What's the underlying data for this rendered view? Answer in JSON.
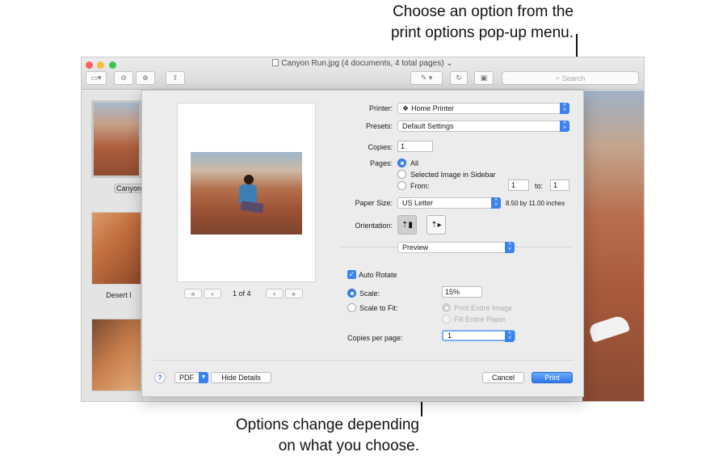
{
  "callouts": {
    "top_line1": "Choose an option from the",
    "top_line2": "print options pop-up menu.",
    "bottom_line1": "Options change depending",
    "bottom_line2": "on what you choose."
  },
  "window": {
    "title": "Canyon Run.jpg (4 documents, 4 total pages)",
    "search_placeholder": "Search"
  },
  "sidebar": {
    "items": [
      {
        "label": "Canyon "
      },
      {
        "label": "Desert I"
      }
    ]
  },
  "print": {
    "pager": {
      "first": "«",
      "prev": "‹",
      "page_text": "1 of 4",
      "next": "›",
      "last": "»"
    },
    "printer_label": "Printer:",
    "printer_value": "Home Printer",
    "presets_label": "Presets:",
    "presets_value": "Default Settings",
    "copies_label": "Copies:",
    "copies_value": "1",
    "pages_label": "Pages:",
    "pages_all": "All",
    "pages_selected": "Selected Image in Sidebar",
    "pages_from": "From:",
    "from_value": "1",
    "to_label": "to:",
    "to_value": "1",
    "paper_size_label": "Paper Size:",
    "paper_size_value": "US Letter",
    "paper_dims": "8.50 by 11.00 inches",
    "orientation_label": "Orientation:",
    "options_menu_value": "Preview",
    "auto_rotate": "Auto Rotate",
    "scale_label": "Scale:",
    "scale_value": "15%",
    "scale_to_fit": "Scale to Fit:",
    "print_entire": "Print Entire Image",
    "fill_paper": "Fill Entire Paper",
    "copies_per_page_label": "Copies per page:",
    "copies_per_page_value": "1",
    "help": "?",
    "pdf": "PDF",
    "hide_details": "Hide Details",
    "cancel": "Cancel",
    "print": "Print"
  },
  "colors": {
    "accent": "#3b82f1"
  }
}
